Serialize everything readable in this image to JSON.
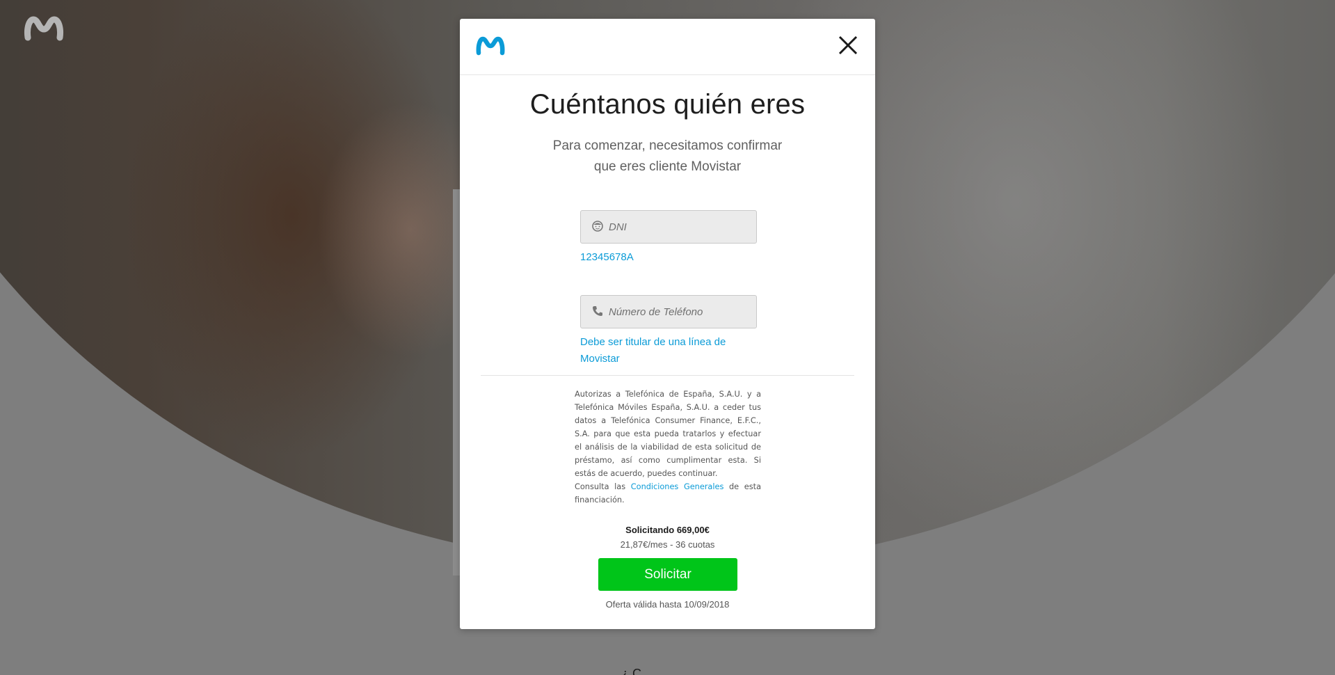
{
  "background": {
    "brand_icon": "movistar-logo-icon",
    "bottom_text": "¿ C"
  },
  "modal": {
    "logo_icon": "movistar-logo-icon",
    "close_icon": "close-icon",
    "title": "Cuéntanos quién eres",
    "subtitle": "Para comenzar, necesitamos confirmar que eres cliente Movistar",
    "dni": {
      "icon": "id-face-icon",
      "placeholder": "DNI",
      "hint": "12345678A"
    },
    "phone": {
      "icon": "phone-icon",
      "placeholder": "Número de Teléfono",
      "hint": "Debe ser titular de una línea de Movistar"
    },
    "legal": {
      "text": "Autorizas a Telefónica de España, S.A.U. y a Telefónica Móviles España, S.A.U. a ceder tus datos a Telefónica Consumer Finance, E.F.C., S.A. para que esta pueda tratarlos y efectuar el análisis de la viabilidad de esta solicitud de préstamo, así como cumplimentar esta. Si estás de acuerdo, puedes continuar.",
      "consult_prefix": "Consulta las",
      "conditions_link": "Condiciones Generales",
      "consult_suffix": "de esta financiación."
    },
    "amount": "Solicitando 669,00€",
    "installments": "21,87€/mes - 36 cuotas",
    "submit_label": "Solicitar",
    "offer": "Oferta válida hasta 10/09/2018"
  },
  "colors": {
    "brand_blue": "#0b9bd7",
    "submit_green": "#00c519",
    "title_dark": "#1e1e1e"
  }
}
